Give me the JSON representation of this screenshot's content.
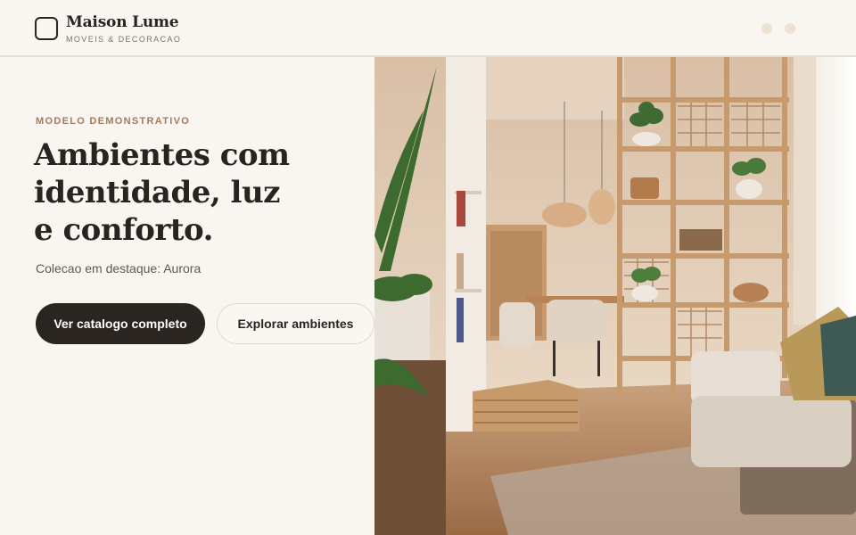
{
  "brand": {
    "name": "Maison Lume",
    "subtitle": "MOVEIS & DECORACAO"
  },
  "hero": {
    "eyebrow": "MODELO DEMONSTRATIVO",
    "headline": [
      "Ambientes com",
      "identidade, luz",
      "e conforto."
    ],
    "tagline": "Colecao em destaque: Aurora",
    "primary_button": "Ver catalogo completo",
    "secondary_button": "Explorar ambientes",
    "image_alt": "Sala de estar e jantar com estante vazada de madeira"
  },
  "colors": {
    "background": "#f9f6f2",
    "accent": "#a67a5a",
    "primary_button": "#2b2521",
    "text": "#2a2420"
  }
}
